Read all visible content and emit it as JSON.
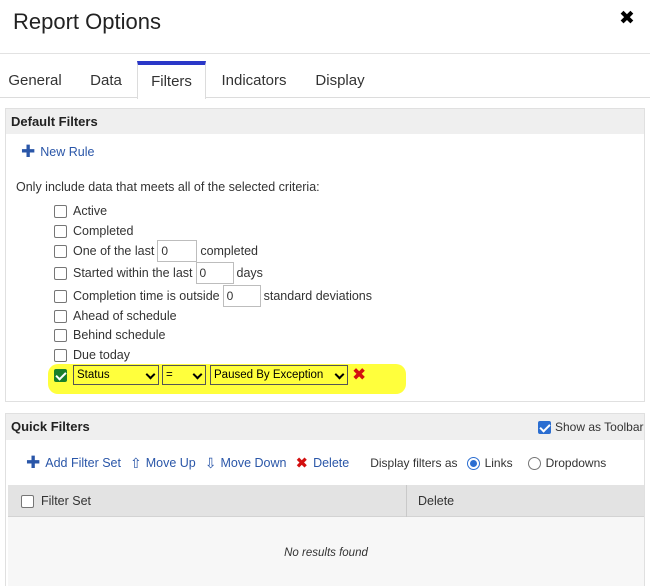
{
  "dialog": {
    "title": "Report Options"
  },
  "tabs": [
    {
      "label": "General"
    },
    {
      "label": "Data"
    },
    {
      "label": "Filters",
      "active": true
    },
    {
      "label": "Indicators"
    },
    {
      "label": "Display"
    }
  ],
  "default_filters": {
    "header": "Default Filters",
    "new_rule": "New Rule",
    "intro": "Only include data that meets all of the selected criteria:",
    "rules": {
      "active": {
        "label": "Active",
        "checked": false
      },
      "completed": {
        "label": "Completed",
        "checked": false
      },
      "one_of_last": {
        "before": "One of the last",
        "value": "0",
        "after": "completed",
        "checked": false
      },
      "started_within": {
        "before": "Started within the last",
        "value": "0",
        "after": "days",
        "checked": false
      },
      "completion_time": {
        "before": "Completion time is outside",
        "value": "0",
        "after": "standard deviations",
        "checked": false
      },
      "ahead": {
        "label": "Ahead of schedule",
        "checked": false
      },
      "behind": {
        "label": "Behind schedule",
        "checked": false
      },
      "due_today": {
        "label": "Due today",
        "checked": false
      }
    },
    "custom_rule": {
      "checked": true,
      "field": "Status",
      "operator": "=",
      "value": "Paused By Exception",
      "highlight_color": "#ffff3c"
    }
  },
  "quick_filters": {
    "header": "Quick Filters",
    "show_as_toolbar": {
      "label": "Show as Toolbar",
      "checked": true
    },
    "toolbar": {
      "add": "Add Filter Set",
      "move_up": "Move Up",
      "move_down": "Move Down",
      "delete": "Delete",
      "display_as": "Display filters as",
      "options": [
        {
          "label": "Links",
          "selected": true
        },
        {
          "label": "Dropdowns",
          "selected": false
        }
      ]
    },
    "table": {
      "columns": [
        "Filter Set",
        "Delete"
      ],
      "empty_text": "No results found"
    }
  },
  "colors": {
    "accent": "#2a37c8",
    "link": "#2a56a8",
    "danger": "#d31010",
    "check": "#1a7f2a"
  }
}
